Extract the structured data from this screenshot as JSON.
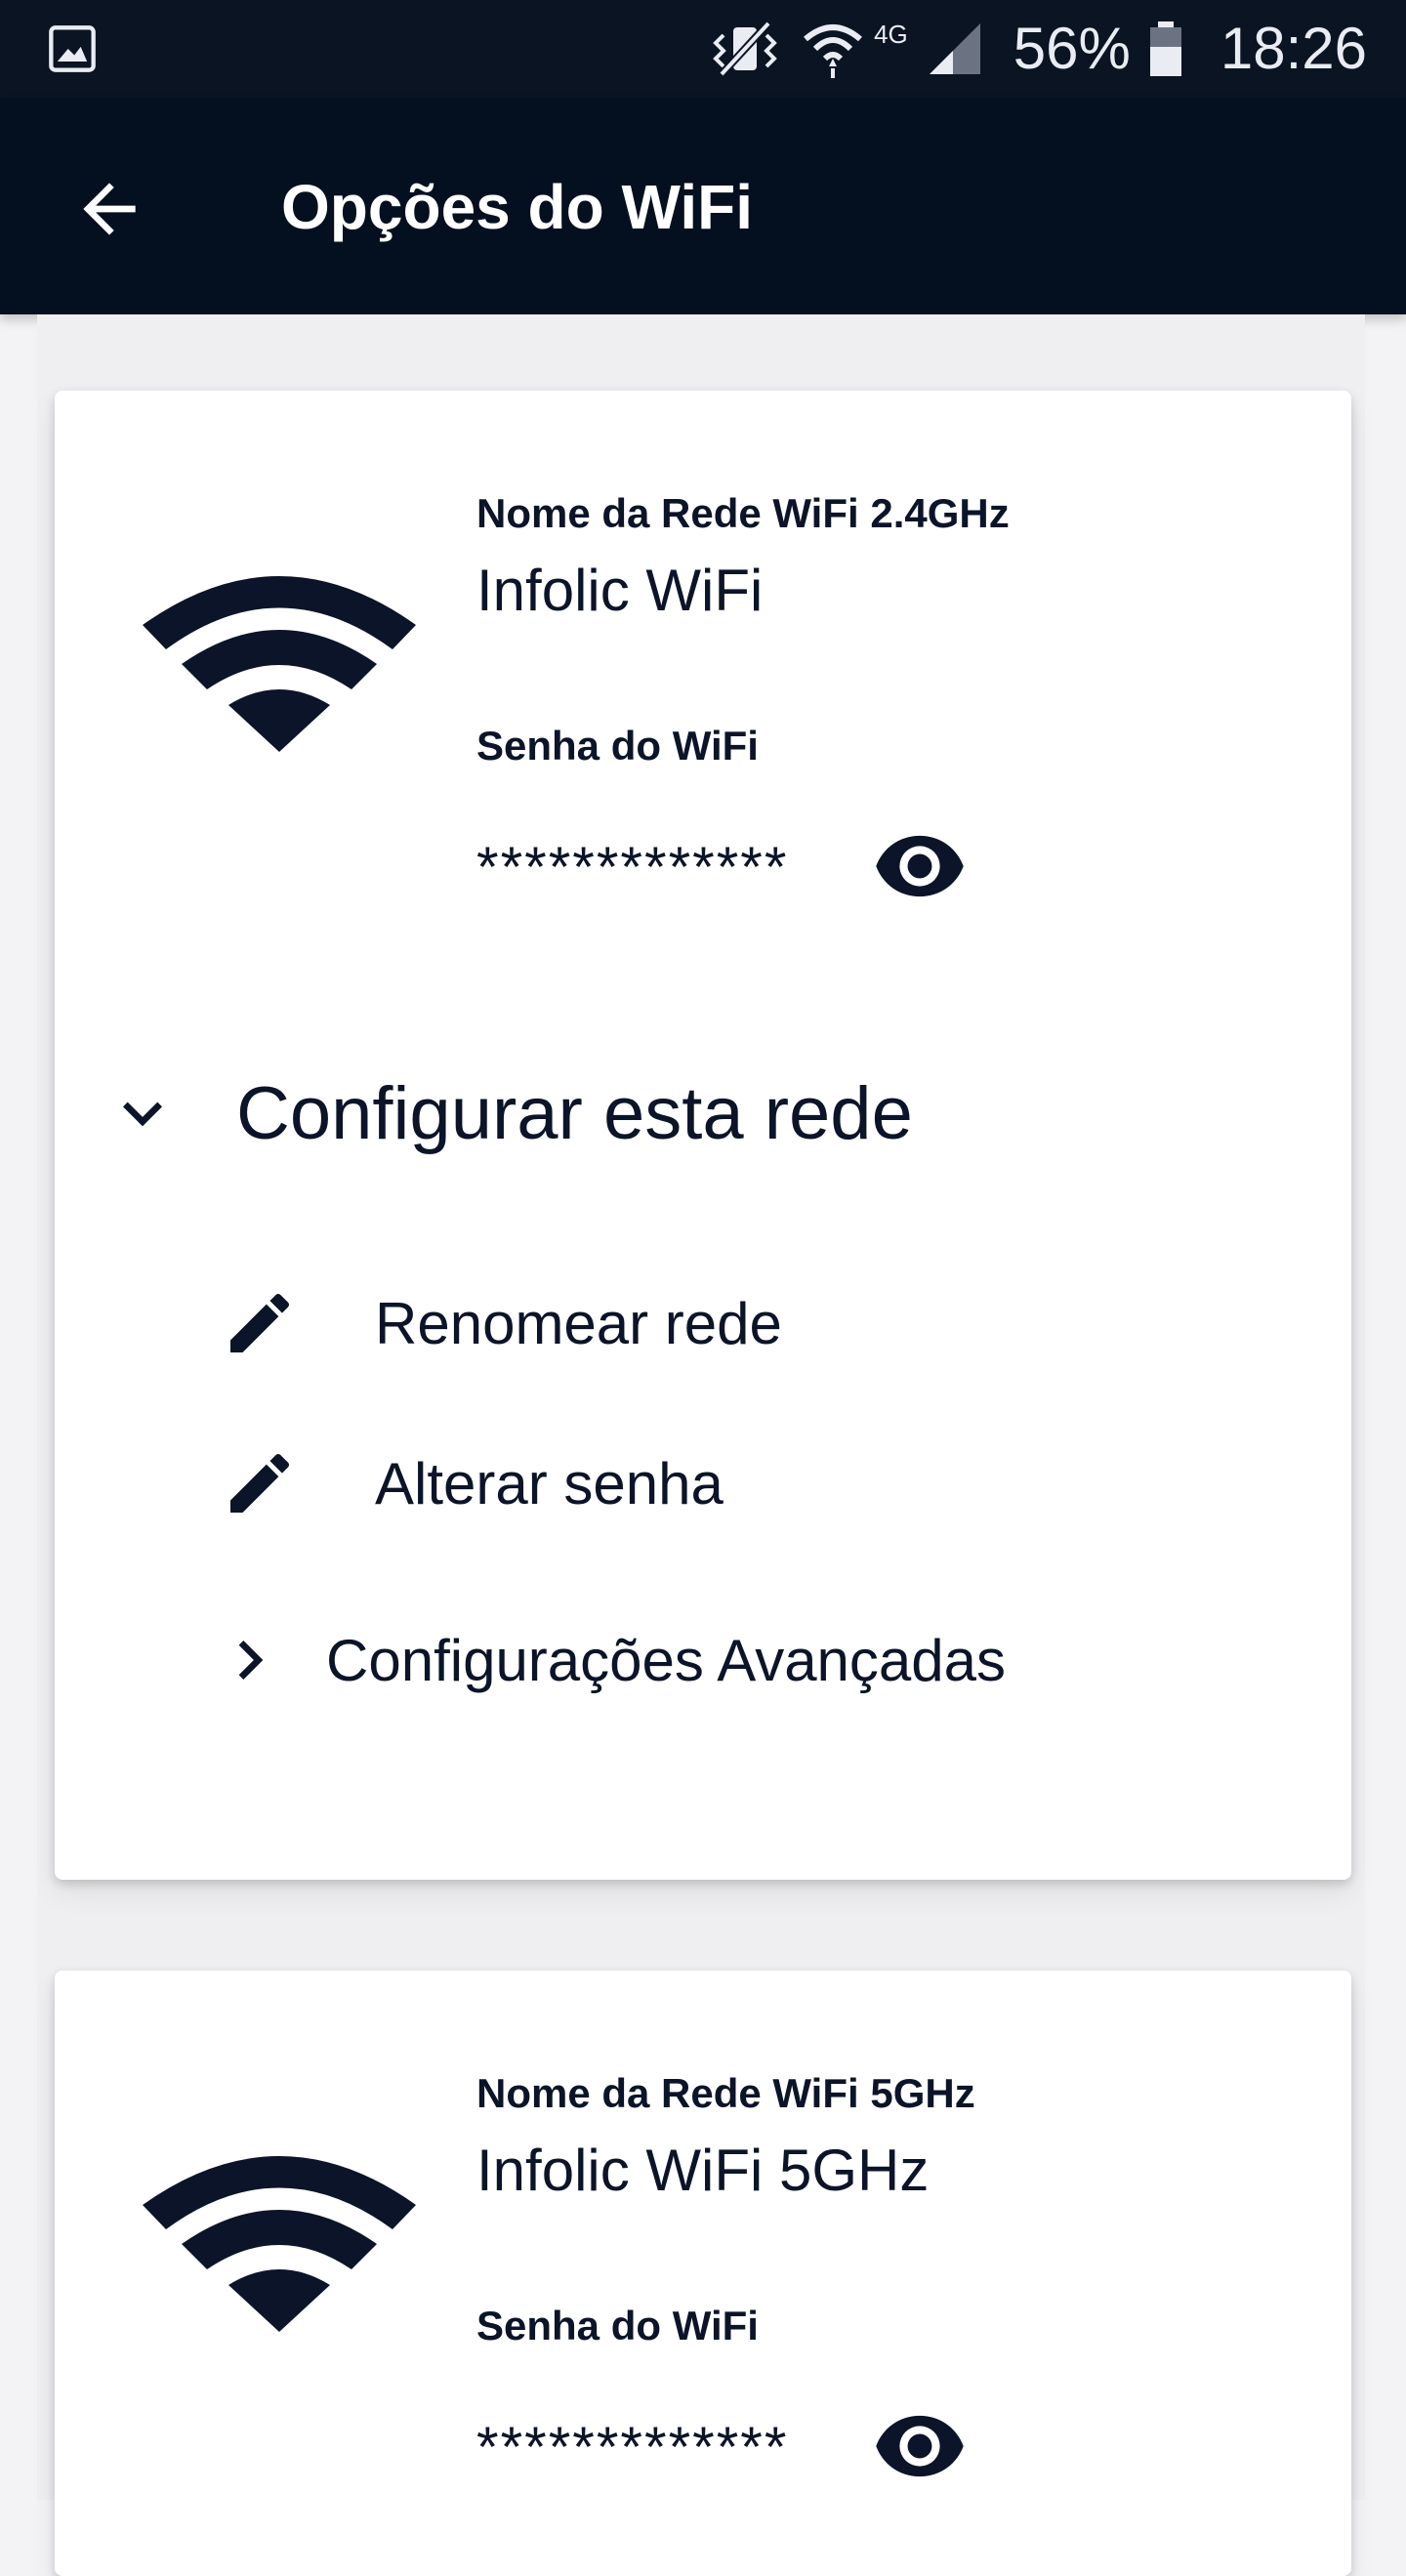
{
  "status_bar": {
    "battery_percent": "56%",
    "time": "18:26",
    "network_type": "4G",
    "icons": [
      "gallery-icon",
      "mute-vibrate-icon",
      "wifi-status-icon",
      "signal-icon",
      "battery-icon"
    ]
  },
  "app_bar": {
    "title": "Opções do WiFi",
    "back_icon": "arrow-back-icon"
  },
  "networks": [
    {
      "name_label": "Nome da Rede WiFi 2.4GHz",
      "name_value": "Infolic WiFi",
      "password_label": "Senha do WiFi",
      "password_masked": "*************",
      "configure": {
        "label": "Configurar esta rede",
        "expanded": true,
        "actions": [
          {
            "label": "Renomear rede",
            "icon": "pencil-icon"
          },
          {
            "label": "Alterar senha",
            "icon": "pencil-icon"
          }
        ],
        "advanced_label": "Configurações Avançadas"
      }
    },
    {
      "name_label": "Nome da Rede WiFi 5GHz",
      "name_value": "Infolic WiFi 5GHz",
      "password_label": "Senha do WiFi",
      "password_masked": "*************"
    }
  ],
  "colors": {
    "app_bar_bg": "#04101f",
    "status_bar_bg": "#0a1422",
    "text_primary": "#0b1428",
    "page_bg": "#f3f3f5",
    "card_bg": "#ffffff"
  }
}
